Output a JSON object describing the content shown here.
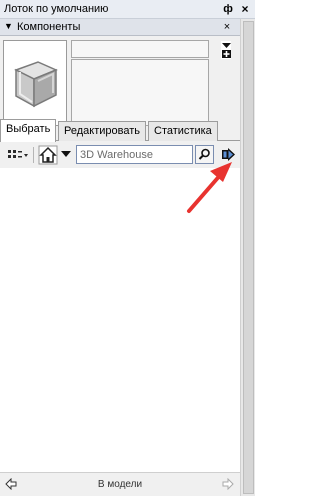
{
  "window": {
    "title": "Лоток по умолчанию",
    "pin_glyph": "ф",
    "close_glyph": "×"
  },
  "section": {
    "title": "Компоненты",
    "close_glyph": "×"
  },
  "tabs": [
    {
      "label": "Выбрать",
      "active": true
    },
    {
      "label": "Редактировать",
      "active": false
    },
    {
      "label": "Статистика",
      "active": false
    }
  ],
  "search": {
    "value": "3D Warehouse"
  },
  "footer": {
    "label": "В модели"
  },
  "colors": {
    "annotation_arrow": "#e8332f",
    "search_border": "#7a8db0"
  }
}
